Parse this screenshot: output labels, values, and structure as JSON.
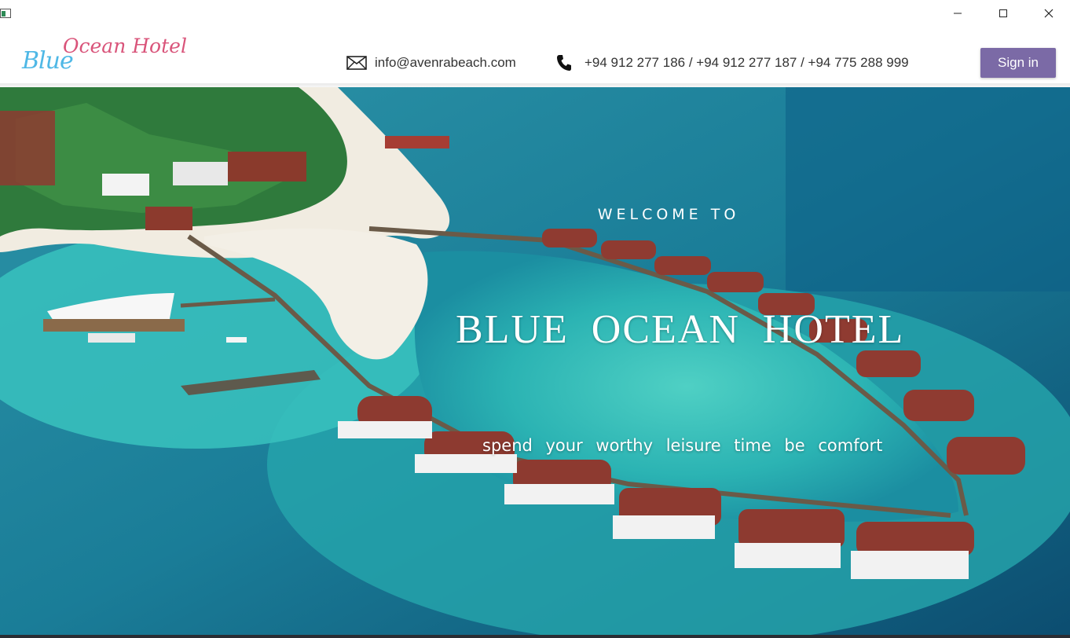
{
  "window": {
    "controls": {
      "minimize_icon": "minimize-icon",
      "maximize_icon": "maximize-icon",
      "close_icon": "close-icon"
    }
  },
  "header": {
    "logo": {
      "part1": "Blue",
      "part2": "Ocean Hotel",
      "color_blue": "#4fb8e6",
      "color_pink": "#d9547a"
    },
    "email": {
      "icon": "mail-icon",
      "text": "info@avenrabeach.com"
    },
    "phone": {
      "icon": "phone-icon",
      "text": "+94 912 277 186 / +94 912 277 187 / +94 775 288 999"
    },
    "signin_label": "Sign in",
    "accent": "#7b6aa6"
  },
  "hero": {
    "welcome": "WELCOME TO",
    "title": "BLUE OCEAN HOTEL",
    "tagline": "spend your worthy leisure time be comfort"
  }
}
